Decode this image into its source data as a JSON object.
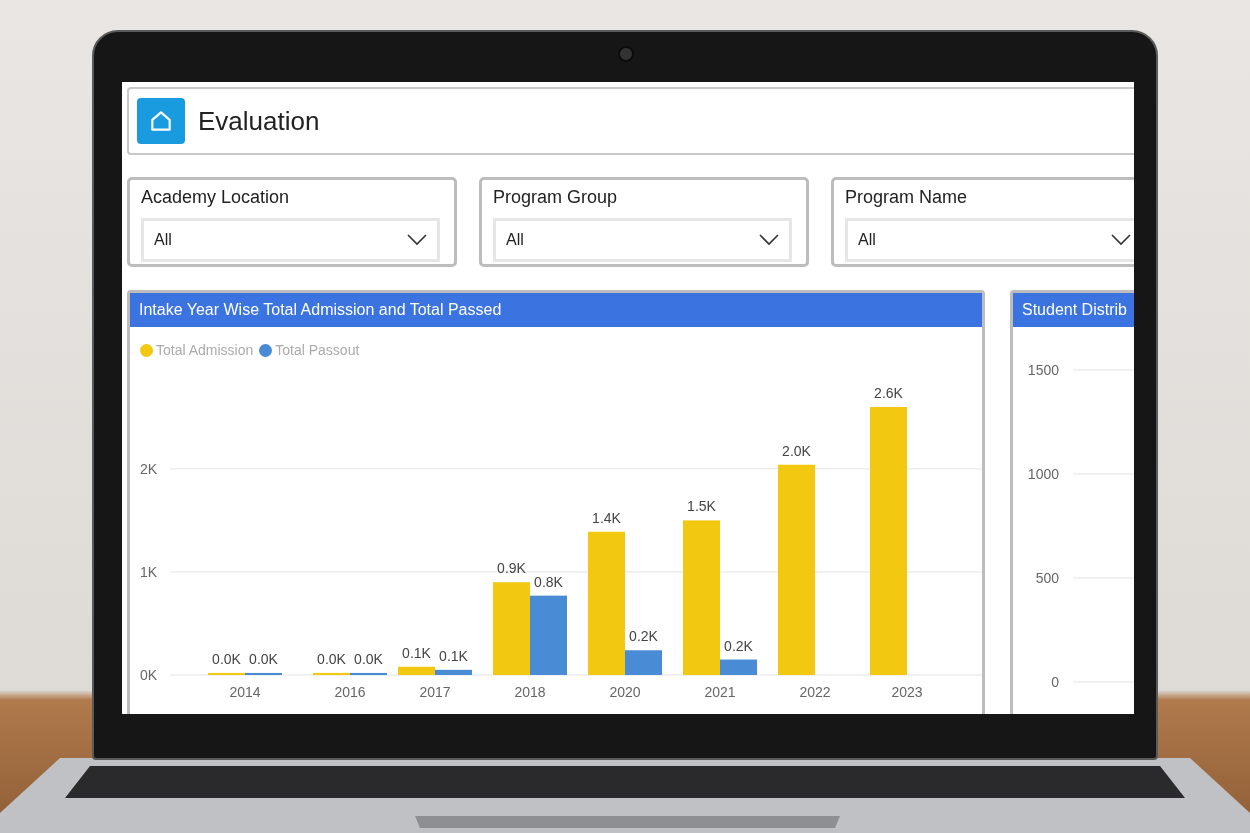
{
  "header": {
    "title": "Evaluation"
  },
  "filters": [
    {
      "label": "Academy Location",
      "value": "All"
    },
    {
      "label": "Program Group",
      "value": "All"
    },
    {
      "label": "Program Name",
      "value": "All"
    }
  ],
  "main_chart": {
    "title": "Intake Year Wise Total Admission and Total Passed",
    "chart_data": {
      "type": "bar",
      "categories": [
        "2014",
        "2016",
        "2017",
        "2018",
        "2020",
        "2021",
        "2022",
        "2023"
      ],
      "series": [
        {
          "name": "Total Admission",
          "color": "#f2c811",
          "values": [
            0.02,
            0.02,
            0.08,
            0.9,
            1.39,
            1.5,
            2.04,
            2.6
          ],
          "value_labels": [
            "0.0K",
            "0.0K",
            "0.1K",
            "0.9K",
            "1.4K",
            "1.5K",
            "2.0K",
            "2.6K"
          ]
        },
        {
          "name": "Total Passout",
          "color": "#4a8bd6",
          "values": [
            0.02,
            0.02,
            0.05,
            0.77,
            0.24,
            0.15,
            null,
            null
          ],
          "value_labels": [
            "0.0K",
            "0.0K",
            "0.1K",
            "0.8K",
            "0.2K",
            "0.2K",
            null,
            null
          ]
        }
      ],
      "ylim": [
        0,
        2.6
      ],
      "yticks": [
        {
          "value": 0,
          "label": "0K"
        },
        {
          "value": 1,
          "label": "1K"
        },
        {
          "value": 2,
          "label": "2K"
        }
      ],
      "data_labels": true
    }
  },
  "side_chart": {
    "title": "Student Distrib",
    "y_ticks": [
      "1500",
      "1000",
      "500",
      "0"
    ]
  }
}
